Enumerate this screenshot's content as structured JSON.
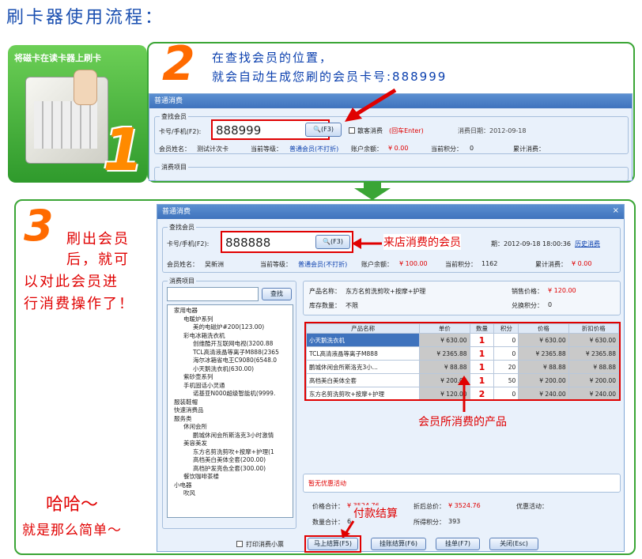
{
  "header": {
    "title": "刷卡器使用流程："
  },
  "step1": {
    "label": "将磁卡在读卡器上刷卡",
    "number": "1"
  },
  "step2": {
    "number": "2",
    "line1": "在查找会员的位置，",
    "line2": "就会自动生成您刷的会员卡号:888999"
  },
  "step3": {
    "number": "3",
    "line1": "刷出会员",
    "line2": "后，就可",
    "line3": "以对此会员进",
    "line4": "行消费操作了！"
  },
  "footer": {
    "haha": "哈哈～",
    "simple": "就是那么简单～"
  },
  "win1": {
    "title": "普通消费",
    "group_label": "查找会员",
    "card_label": "卡号/手机(F2):",
    "card_value": "888999",
    "search_btn": "(F3)",
    "walkin_label": "散客消费",
    "walkin_hint": "(回车Enter)",
    "date_label": "消费日期：2012-09-18",
    "name_label": "会员姓名：",
    "name_value": "测试计次卡",
    "level_label": "当前等级：",
    "level_value": "普通会员(不打折)",
    "balance_label": "账户余额：",
    "balance_value": "¥ 0.00",
    "points_label": "当前积分：",
    "points_value": "0",
    "total_label": "累计消费：",
    "items_label": "消费项目"
  },
  "win2": {
    "title": "普通消费",
    "group_label": "查找会员",
    "card_label": "卡号/手机(F2):",
    "card_value": "888888",
    "search_btn": "(F3)",
    "annotation": "来店消费的会员",
    "date_suffix": "期：2012-09-18 18:00:36",
    "history_link": "历史消费",
    "name_label": "会员姓名：",
    "name_value": "吴新洲",
    "level_label": "当前等级：",
    "level_value": "普通会员(不打折)",
    "balance_label": "账户余额：",
    "balance_value": "¥ 100.00",
    "points_label": "当前积分：",
    "points_value": "1162",
    "total_label": "累计消费：",
    "total_value": "¥ 0.00",
    "items_label": "消费项目",
    "search_button": "查找",
    "tree": [
      "家用电器",
      "电暖炉系列",
      "美的电磁炉#200(123.00)",
      "彩电冰箱洗衣机",
      "创维酷开互联网电视(3200.88",
      "TCL高清液晶等离子M888(2365",
      "海尔冰箱省电王C9080(6548.0",
      "小天鹅洗衣机(630.00)",
      "紫砂壶系列",
      "手机固话小灵通",
      "诺基亚N000超级智能机(9999.",
      "服装鞋帽",
      "快速消费品",
      "服务类",
      "休闲会所",
      "鹏城休闲会所斯洛克3小时激情",
      "美容美发",
      "东方名剪洗剪吹+按摩+护理(1",
      "高档美白美体全套(200.00)",
      "高档护发亮色全套(300.00)",
      "餐饮咖啡茶楼",
      "小电器",
      "吹风"
    ],
    "product_name_label": "产品名称：",
    "product_name": "东方名剪洗剪吹+按摩+护理",
    "price_label": "销售价格：",
    "price_value": "¥ 120.00",
    "stock_label": "库存数量：",
    "stock_value": "不限",
    "exchange_label": "兑换积分：",
    "exchange_value": "0",
    "table_headers": [
      "产品名称",
      "单价",
      "数量",
      "积分",
      "价格",
      "折扣价格"
    ],
    "rows": [
      [
        "小天鹅洗衣机",
        "¥ 630.00",
        "1",
        "0",
        "¥ 630.00",
        "¥ 630.00"
      ],
      [
        "TCL高清液晶等离子M888",
        "¥ 2365.88",
        "1",
        "0",
        "¥ 2365.88",
        "¥ 2365.88"
      ],
      [
        "鹏城休闲会所斯洛克3小...",
        "¥ 88.88",
        "1",
        "20",
        "¥ 88.88",
        "¥ 88.88"
      ],
      [
        "高档美白美体全套",
        "¥ 200.00",
        "1",
        "50",
        "¥ 200.00",
        "¥ 200.00"
      ],
      [
        "东方名剪洗剪吹+按摩+护理",
        "¥ 120.00",
        "2",
        "0",
        "¥ 240.00",
        "¥ 240.00"
      ]
    ],
    "products_annotation": "会员所消费的产品",
    "promo_label": "暂无优惠活动",
    "total_price_label": "价格合计：",
    "total_price_value": "¥ 3524.76",
    "discount_total_label": "折后总价：",
    "discount_total_value": "¥ 3524.76",
    "promo_activity_label": "优惠活动：",
    "qty_total_label": "数量合计：",
    "qty_total_value": "6",
    "earned_points_label": "所得积分：",
    "earned_points_value": "393",
    "pay_annotation": "付款结算",
    "print_label": "打印消费小票",
    "btn_checkout": "马上结算(F5)",
    "btn_hang": "挂账结算(F6)",
    "btn_hold": "挂单(F7)",
    "btn_close": "关闭(Esc)"
  }
}
